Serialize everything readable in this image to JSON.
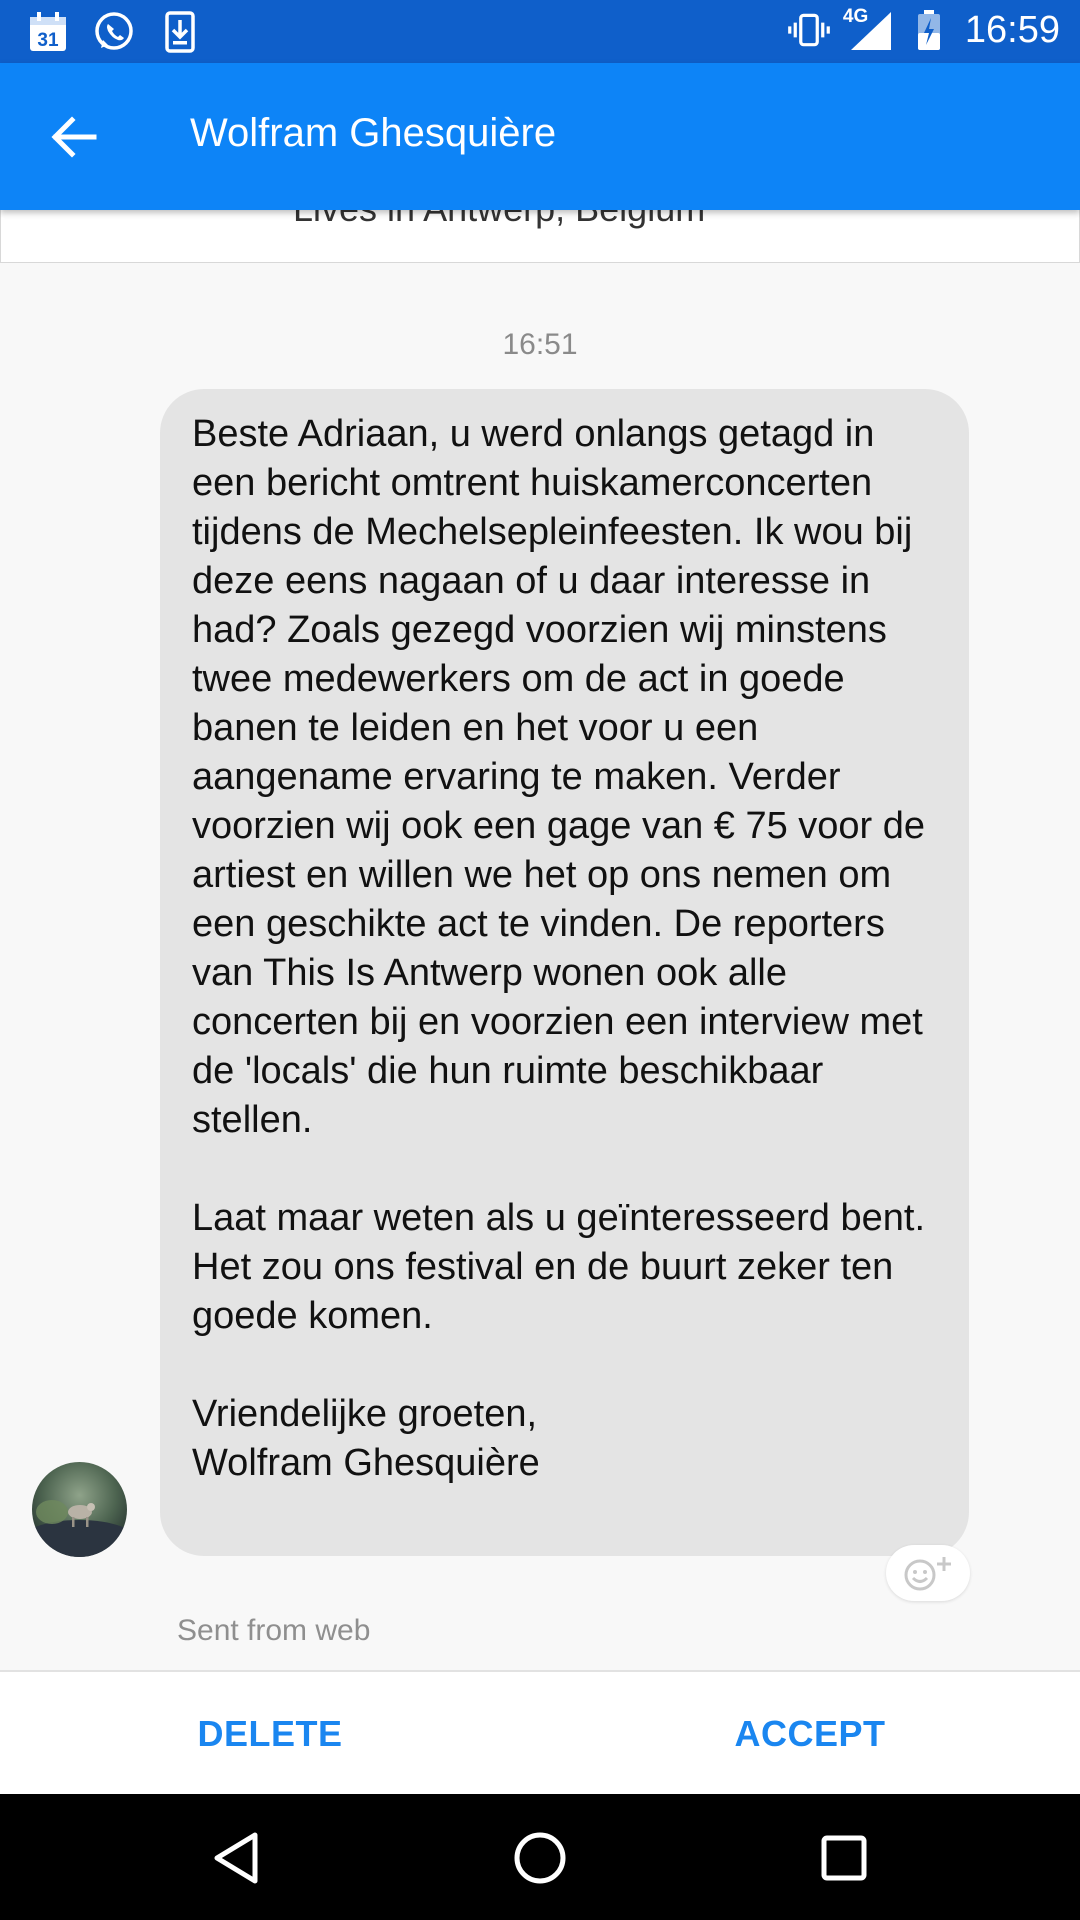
{
  "status_bar": {
    "calendar_day": "31",
    "network_label": "4G",
    "time": "16:59",
    "icons": [
      "calendar-icon",
      "whatsapp-icon",
      "download-icon",
      "vibrate-icon",
      "signal-icon",
      "battery-charging-icon"
    ]
  },
  "app_bar": {
    "title": "Wolfram Ghesquière",
    "back_icon": "arrow-back-icon"
  },
  "profile": {
    "location": "Lives in Antwerp, Belgium"
  },
  "conversation": {
    "timestamp": "16:51",
    "message": "Beste Adriaan, u werd onlangs getagd in een bericht omtrent huiskamerconcerten tijdens de Mechelsepleinfeesten. Ik wou bij deze eens nagaan of u daar interesse in had? Zoals gezegd voorzien wij minstens twee medewerkers om de act in goede banen te leiden en het voor u een aangename ervaring te maken. Verder voorzien wij ook een gage van € 75 voor de artiest en willen we het op ons nemen om een geschikte act te vinden. De reporters van This Is Antwerp wonen ook alle concerten bij en voorzien een interview met de 'locals' die hun ruimte beschikbaar stellen.\n\nLaat maar weten als u geïnteresseerd bent. Het zou ons festival en de buurt zeker ten goede komen.\n\nVriendelijke groeten,\nWolfram Ghesquière",
    "sent_from": "Sent from web"
  },
  "actions": {
    "delete_label": "DELETE",
    "accept_label": "ACCEPT"
  },
  "colors": {
    "status_bar": "#0f5fca",
    "app_bar": "#0d84f7",
    "accent": "#1a86f0",
    "bubble": "#e4e4e4"
  }
}
